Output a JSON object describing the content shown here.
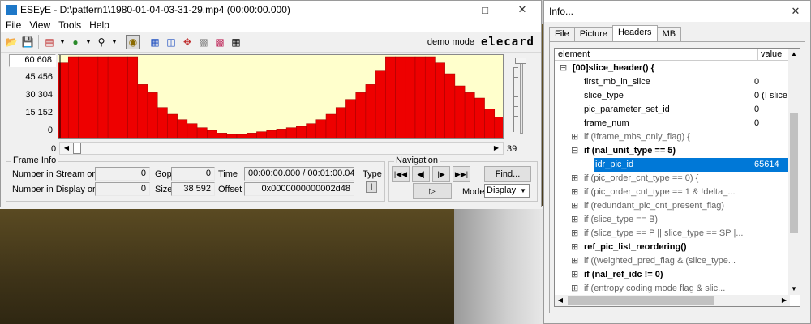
{
  "main_window": {
    "title": "ESEyE - D:\\pattern1\\1980-01-04-03-31-29.mp4 (00:00:00.000)",
    "menu": [
      "File",
      "View",
      "Tools",
      "Help"
    ],
    "mode_label": "demo mode",
    "logo_text": "elecard"
  },
  "chart_data": {
    "type": "bar",
    "title": "",
    "xlabel": "",
    "ylabel": "",
    "y_ticks": [
      "60 608",
      "45 456",
      "30 304",
      "15 152",
      "0"
    ],
    "ylim": [
      0,
      60608
    ],
    "x_ticks": [
      "0",
      "39"
    ],
    "bar_color": "#ee0000",
    "background_color": "#ffffcc",
    "values": [
      56000,
      60600,
      60600,
      60600,
      60600,
      60600,
      60600,
      60600,
      40000,
      34000,
      23000,
      18000,
      14000,
      11000,
      8000,
      6000,
      4000,
      3000,
      3000,
      4000,
      5000,
      6000,
      7000,
      8000,
      9000,
      11000,
      14000,
      18000,
      23000,
      29000,
      34000,
      40000,
      50000,
      60600,
      60600,
      60600,
      60600,
      60600,
      56000,
      48000,
      39000,
      34000,
      30000,
      22000,
      16000
    ]
  },
  "frame_info": {
    "title": "Frame Info",
    "stream_order_label": "Number in Stream order",
    "stream_order_value": "0",
    "display_order_label": "Number in Display order",
    "display_order_value": "0",
    "gop_label": "Gop",
    "gop_value": "0",
    "size_label": "Size",
    "size_value": "38 592",
    "time_label": "Time",
    "time_value": "00:00:00.000 / 00:01:00.049",
    "offset_label": "Offset",
    "offset_value": "0x0000000000002d48",
    "type_label": "Type",
    "type_value": "I"
  },
  "navigation": {
    "title": "Navigation",
    "find_label": "Find...",
    "mode_label": "Mode",
    "mode_value": "Display"
  },
  "info_window": {
    "title": "Info...",
    "tabs": [
      "File",
      "Picture",
      "Headers",
      "MB"
    ],
    "active_tab": "Headers",
    "columns": [
      "element",
      "value"
    ],
    "rows": [
      {
        "indent": 0,
        "expander": "minus",
        "bold": true,
        "element": "[00]slice_header() {",
        "value": ""
      },
      {
        "indent": 1,
        "expander": "",
        "bold": false,
        "element": "first_mb_in_slice",
        "value": "0"
      },
      {
        "indent": 1,
        "expander": "",
        "bold": false,
        "element": "slice_type",
        "value": "0 (I slice"
      },
      {
        "indent": 1,
        "expander": "",
        "bold": false,
        "element": "pic_parameter_set_id",
        "value": "0"
      },
      {
        "indent": 1,
        "expander": "",
        "bold": false,
        "element": "frame_num",
        "value": "0"
      },
      {
        "indent": 1,
        "expander": "plus",
        "bold": false,
        "element": "if (!frame_mbs_only_flag) {",
        "value": "",
        "muted": true
      },
      {
        "indent": 1,
        "expander": "minus",
        "bold": true,
        "element": "if (nal_unit_type == 5)",
        "value": ""
      },
      {
        "indent": 2,
        "expander": "",
        "bold": false,
        "element": "idr_pic_id",
        "value": "65614",
        "selected": true
      },
      {
        "indent": 1,
        "expander": "plus",
        "bold": false,
        "element": "if (pic_order_cnt_type == 0) {",
        "value": "",
        "muted": true
      },
      {
        "indent": 1,
        "expander": "plus",
        "bold": false,
        "element": "if (pic_order_cnt_type == 1 & !delta_...",
        "value": "",
        "muted": true
      },
      {
        "indent": 1,
        "expander": "plus",
        "bold": false,
        "element": "if (redundant_pic_cnt_present_flag)",
        "value": "",
        "muted": true
      },
      {
        "indent": 1,
        "expander": "plus",
        "bold": false,
        "element": "if (slice_type == B)",
        "value": "",
        "muted": true
      },
      {
        "indent": 1,
        "expander": "plus",
        "bold": false,
        "element": "if (slice_type == P || slice_type == SP |...",
        "value": "",
        "muted": true
      },
      {
        "indent": 1,
        "expander": "plus",
        "bold": true,
        "element": "ref_pic_list_reordering()",
        "value": ""
      },
      {
        "indent": 1,
        "expander": "plus",
        "bold": false,
        "element": "if ((weighted_pred_flag & (slice_type...",
        "value": "",
        "muted": true
      },
      {
        "indent": 1,
        "expander": "plus",
        "bold": true,
        "element": "if (nal_ref_idc != 0)",
        "value": ""
      },
      {
        "indent": 1,
        "expander": "plus",
        "bold": false,
        "element": "if (entropy coding mode flag & slic...",
        "value": "",
        "muted": true
      }
    ]
  }
}
